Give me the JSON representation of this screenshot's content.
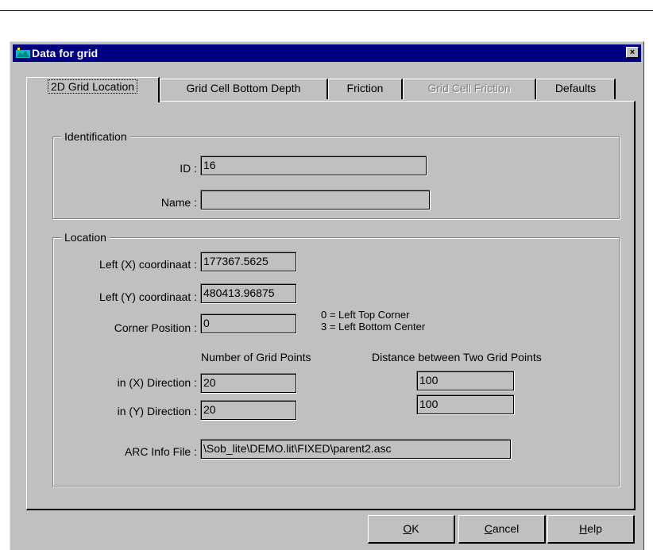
{
  "window": {
    "title": "Data for grid",
    "close_glyph": "×"
  },
  "tabs": [
    {
      "label": "2D Grid Location",
      "state": "active"
    },
    {
      "label": "Grid Cell Bottom Depth",
      "state": "normal"
    },
    {
      "label": "Friction",
      "state": "normal"
    },
    {
      "label": "Grid Cell Friction",
      "state": "disabled"
    },
    {
      "label": "Defaults",
      "state": "normal"
    }
  ],
  "identification": {
    "legend": "Identification",
    "id_label": "ID :",
    "id_value": "16",
    "name_label": "Name :",
    "name_value": ""
  },
  "location": {
    "legend": "Location",
    "left_x_label": "Left (X) coordinaat :",
    "left_x_value": "177367.5625",
    "left_y_label": "Left (Y) coordinaat :",
    "left_y_value": "480413.96875",
    "corner_label": "Corner Position :",
    "corner_value": "0",
    "corner_hint_1": "0 = Left Top Corner",
    "corner_hint_2": "3 = Left Bottom Center",
    "num_points_header": "Number of Grid Points",
    "distance_header": "Distance between Two Grid Points",
    "x_dir_label": "in (X) Direction :",
    "x_points": "20",
    "x_distance": "100",
    "y_dir_label": "in (Y) Direction :",
    "y_points": "20",
    "y_distance": "100",
    "arc_label": "ARC Info File :",
    "arc_value": "\\Sob_lite\\DEMO.lit\\FIXED\\parent2.asc"
  },
  "buttons": {
    "ok_mnemonic": "O",
    "ok_rest": "K",
    "cancel_mnemonic": "C",
    "cancel_rest": "ancel",
    "help_mnemonic": "H",
    "help_rest": "elp"
  },
  "colors": {
    "titlebar": "#000080",
    "face": "#c0c0c0"
  }
}
